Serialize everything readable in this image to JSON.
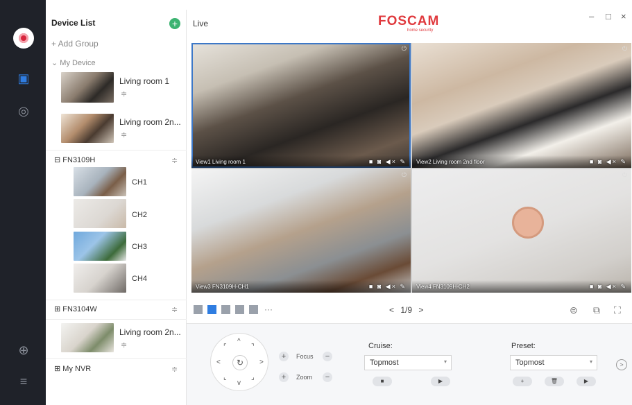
{
  "device_list": {
    "title": "Device List",
    "add_group": "+ Add Group",
    "my_device": "My Device",
    "devices": [
      {
        "label": "Living room 1"
      },
      {
        "label": "Living room 2n..."
      }
    ],
    "groups": [
      {
        "label": "FN3109H",
        "channels": [
          "CH1",
          "CH2",
          "CH3",
          "CH4"
        ]
      },
      {
        "label": "FN3104W"
      }
    ],
    "extra_device": {
      "label": "Living room 2n..."
    },
    "nvr": {
      "label": "My NVR"
    }
  },
  "header": {
    "live_label": "Live",
    "brand": "FOSCAM",
    "brand_sub": "home security",
    "minimize": "–",
    "maximize": "□",
    "close": "×"
  },
  "views": [
    {
      "label": "View1 Living room 1",
      "tools": "■ ◙ ◀× ✎"
    },
    {
      "label": "View2 Living room 2nd floor",
      "tools": "■ ◙ ◀× ✎"
    },
    {
      "label": "View3 FN3109H-CH1",
      "tools": "■ ◙ ◀× ✎"
    },
    {
      "label": "View4 FN3109H-CH2",
      "tools": "■ ◙ ◀× ✎"
    }
  ],
  "toolbar": {
    "more": "···",
    "prev": "<",
    "page": "1/9",
    "next": ">"
  },
  "ptz": {
    "focus": "Focus",
    "zoom": "Zoom",
    "cruise_title": "Cruise:",
    "cruise_value": "Topmost",
    "preset_title": "Preset:",
    "preset_value": "Topmost",
    "plus": "+",
    "minus": "−",
    "stop": "■",
    "play": "▶",
    "add": "+",
    "delete": "🗑",
    "next": ">"
  },
  "colors": {
    "accent": "#2f7de1",
    "brand": "#e03a3e",
    "rail": "#1f2229"
  }
}
